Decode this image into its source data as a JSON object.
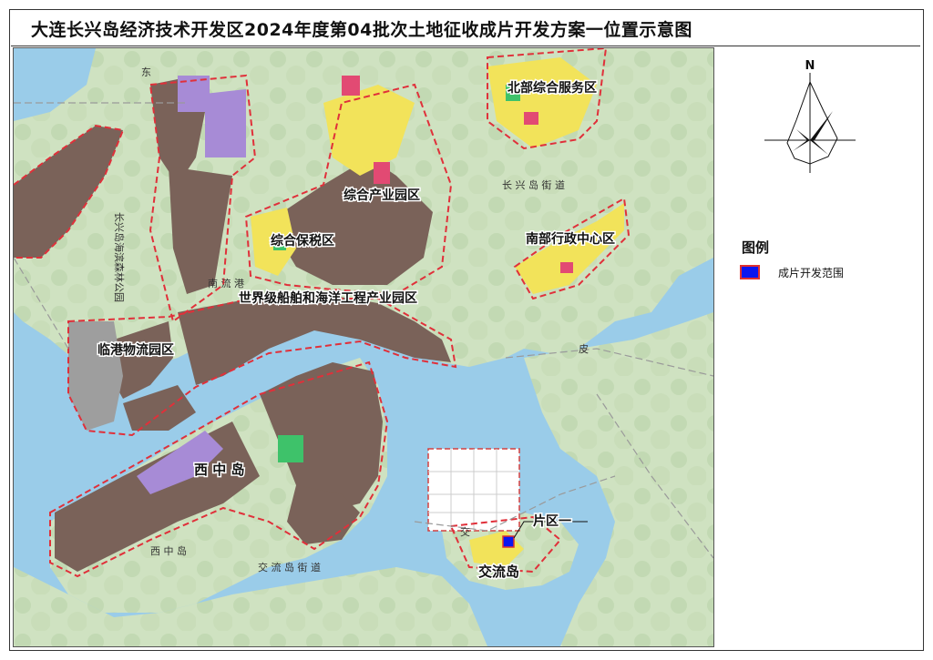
{
  "title": "大连长兴岛经济技术开发区2024年度第04批次土地征收成片开发方案一位置示意图",
  "compass": {
    "north_label": "N"
  },
  "legend": {
    "title": "图例",
    "items": [
      {
        "label": "成片开发范围",
        "fill": "#0a16f0",
        "border": "#e03030"
      }
    ]
  },
  "areas": {
    "north_service": "北部综合服务区",
    "industrial_park": "综合产业园区",
    "bonded_zone": "综合保税区",
    "south_admin": "南部行政中心区",
    "shipbuilding": "世界级船舶和海洋工程产业园区",
    "logistics": "临港物流园区",
    "xizhong_island": "西 中 岛",
    "jiaoliu_island": "交流岛",
    "parcel_one": "片区一"
  },
  "roads": {
    "changxing_street": "长 兴 岛 街 道",
    "jiaoliu_street": "交 流 岛 街 道",
    "xizhong_small": "西 中 岛",
    "nanliu_port": "南 流 港",
    "forest_park": "长兴岛海滨森林公园",
    "dong_label": "东",
    "jiao_label": "交",
    "pi_label": "皮"
  },
  "colors": {
    "sea": "#8fc6e6",
    "land": "#d7e6c7",
    "industrial": "#7a6259",
    "boundary": "#e0303a",
    "parcel": "#0a16f0"
  }
}
